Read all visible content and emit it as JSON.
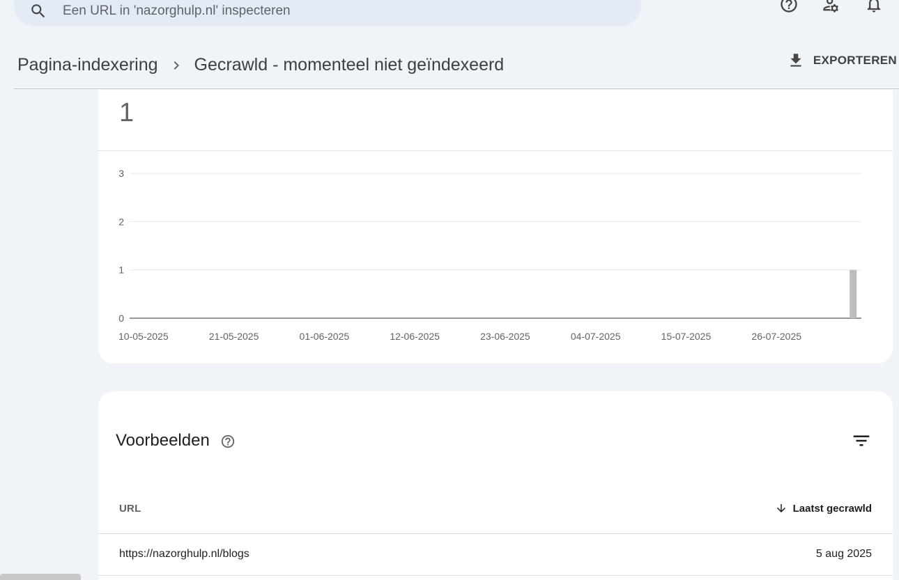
{
  "search": {
    "placeholder": "Een URL in 'nazorghulp.nl' inspecteren",
    "search_icon": "search-icon"
  },
  "top_icons": [
    "help-circle-icon",
    "manage-accounts-icon",
    "notifications-icon"
  ],
  "header": {
    "breadcrumb_parent": "Pagina-indexering",
    "breadcrumb_current": "Gecrawld - momenteel niet geïndexeerd",
    "export_label": "EXPORTEREN"
  },
  "summary": {
    "total": "1"
  },
  "chart_data": {
    "type": "bar",
    "ylim": [
      0,
      3
    ],
    "yticks": [
      "0",
      "1",
      "2",
      "3"
    ],
    "xtick_labels": [
      "10-05-2025",
      "21-05-2025",
      "01-06-2025",
      "12-06-2025",
      "23-06-2025",
      "04-07-2025",
      "15-07-2025",
      "26-07-2025"
    ],
    "x_start": "2025-05-10",
    "x_end": "2025-08-07",
    "bars": [
      {
        "date": "2025-08-06",
        "value": 1
      }
    ],
    "bar_color": "#bdbdbd",
    "grid": true
  },
  "examples": {
    "title": "Voorbeelden",
    "columns": {
      "url": "URL",
      "last_crawled": "Laatst gecrawld"
    },
    "rows": [
      {
        "url": "https://nazorghulp.nl/blogs",
        "last_crawled": "5 aug 2025"
      }
    ]
  },
  "colors": {
    "background": "#f0f3f8",
    "search_bg": "#e3ebf7",
    "notification_badge": "#d93025"
  }
}
